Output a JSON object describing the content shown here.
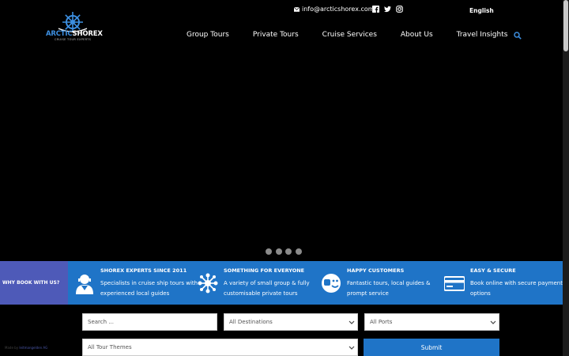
{
  "header": {
    "email": "info@arcticshorex.com",
    "language": "English",
    "logo": {
      "word1": "ARCTIC",
      "word2": "SHOREX",
      "tagline": "CRUISE TOUR EXPERTS"
    },
    "nav": [
      {
        "label": "Group Tours"
      },
      {
        "label": "Private Tours"
      },
      {
        "label": "Cruise Services"
      },
      {
        "label": "About Us"
      },
      {
        "label": "Travel Insights"
      }
    ]
  },
  "slider": {
    "slides": 4
  },
  "features": {
    "why_label": "WHY BOOK WITH US?",
    "items": [
      {
        "title": "SHOREX EXPERTS SINCE 2011",
        "desc": "Specialists in cruise ship tours with experienced local guides",
        "icon": "guide-icon"
      },
      {
        "title": "SOMETHING FOR EVERYONE",
        "desc": "A variety of small group & fully customisable private tours",
        "icon": "network-icon"
      },
      {
        "title": "HAPPY CUSTOMERS",
        "desc": "Fantastic tours, local guides & prompt service",
        "icon": "happy-face-icon"
      },
      {
        "title": "EASY & SECURE",
        "desc": "Book online with secure payment options",
        "icon": "credit-card-icon"
      }
    ]
  },
  "search_form": {
    "search_placeholder": "Search ...",
    "destinations": "All Destinations",
    "ports": "All Ports",
    "themes": "All Tour Themes",
    "submit_label": "Submit"
  },
  "footer": {
    "credit_prefix": "Made by",
    "credit_link": "leitmangelden AG"
  },
  "colors": {
    "accent": "#1f74c7",
    "why_bg": "#4e5ab8",
    "logo_blue": "#3d8fe0"
  }
}
